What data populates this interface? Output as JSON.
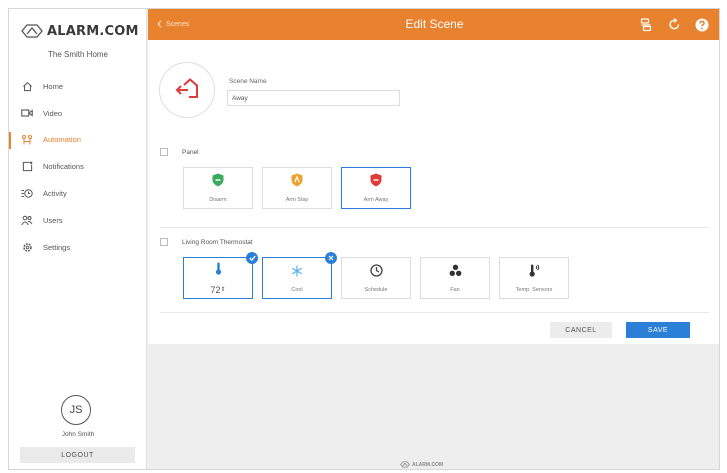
{
  "app": {
    "brand": "ALARM.COM",
    "home_name": "The Smith Home"
  },
  "sidebar": {
    "items": [
      {
        "label": "Home",
        "icon": "home-icon"
      },
      {
        "label": "Video",
        "icon": "video-icon"
      },
      {
        "label": "Automation",
        "icon": "automation-icon",
        "active": true
      },
      {
        "label": "Notifications",
        "icon": "notifications-icon"
      },
      {
        "label": "Activity",
        "icon": "activity-icon"
      },
      {
        "label": "Users",
        "icon": "users-icon"
      },
      {
        "label": "Settings",
        "icon": "settings-icon"
      }
    ],
    "user": {
      "initials": "JS",
      "name": "John Smith"
    },
    "logout_label": "LOGOUT"
  },
  "header": {
    "back_label": "Scenes",
    "title": "Edit Scene",
    "icons": [
      "scene-list-icon",
      "refresh-icon",
      "help-icon"
    ]
  },
  "scene": {
    "name_label": "Scene Name",
    "name_value": "Away",
    "icon": "away-house-icon"
  },
  "panel": {
    "label": "Panel",
    "options": [
      {
        "label": "Disarm",
        "icon": "disarm-shield-icon"
      },
      {
        "label": "Arm Stay",
        "icon": "arm-stay-shield-icon"
      },
      {
        "label": "Arm Away",
        "icon": "arm-away-shield-icon",
        "selected": true
      }
    ]
  },
  "thermostat": {
    "label": "Living Room Thermostat",
    "temperature": "72",
    "options": [
      {
        "label": "",
        "icon": "thermometer-icon",
        "selected": true
      },
      {
        "label": "Cool",
        "icon": "snowflake-icon",
        "selected": true
      },
      {
        "label": "Schedule",
        "icon": "clock-icon"
      },
      {
        "label": "Fan",
        "icon": "fan-icon"
      },
      {
        "label": "Temp. Sensors",
        "icon": "temp-sensors-icon"
      }
    ]
  },
  "actions": {
    "cancel_label": "CANCEL",
    "save_label": "SAVE"
  },
  "footer": {
    "brand": "ALARM.COM"
  },
  "colors": {
    "accent": "#e8822f",
    "primary": "#2b7fd6",
    "disarm": "#3aaa5c",
    "arm_stay": "#f0a030",
    "arm_away": "#e03a3a"
  }
}
